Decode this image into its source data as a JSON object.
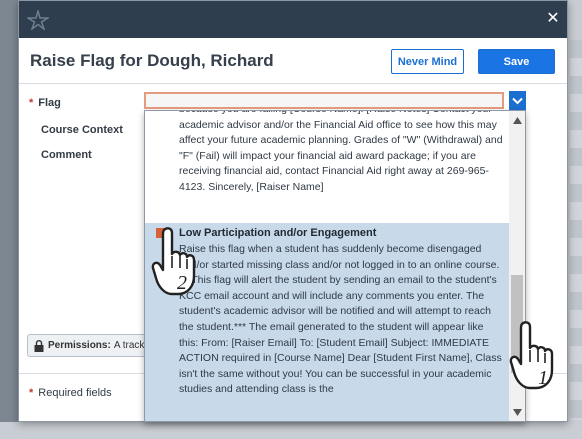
{
  "window": {
    "title": "Raise Flag for Dough, Richard"
  },
  "header": {
    "nevermind_label": "Never Mind",
    "save_label": "Save"
  },
  "form": {
    "flag_label": "Flag",
    "course_context_label": "Course Context",
    "comment_label": "Comment",
    "required_marker": "*",
    "permissions_label": "Permissions:",
    "permissions_value": "A tracki",
    "required_fields_note": "Required fields"
  },
  "dropdown": {
    "previous_option_text": "because you are failing [Course Name]. [Raise Notes] Contact your academic advisor and/or the Financial Aid office to see how this may affect your future academic planning. Grades of \"W\" (Withdrawal) and \"F\" (Fail) will impact your financial aid award package; if you are receiving financial aid, contact Financial Aid right away at 269-965-4123. Sincerely, [Raiser Name]",
    "highlighted_option": {
      "title": "Low Participation and/or Engagement",
      "description": "Raise this flag when a student has suddenly become disengaged and/or started missing class and/or not logged in to an online course. ***This flag will alert the student by sending an email to the student's KCC email account and will include any comments you enter. The student's academic advisor will be notified and will attempt to reach the student.*** The email generated to the student will appear like this: From: [Raiser Email] To: [Student Email] Subject: IMMEDIATE ACTION required in [Course Name] Dear [Student First Name], Class isn't the same without you! You can be successful in your academic studies and attending class is the"
    }
  },
  "annotations": {
    "step_1": "1",
    "step_2": "2"
  },
  "colors": {
    "topbar": "#2f3e4e",
    "primary": "#1b74e4",
    "highlight": "#c8d9ea",
    "required": "#c0392b",
    "flag_icon": "#d7623a"
  },
  "icons": [
    "logo-icon",
    "close-icon",
    "lock-icon",
    "chevron-down-icon",
    "scroll-up-icon",
    "scroll-down-icon",
    "flag-icon",
    "pointer-hand-icon"
  ]
}
